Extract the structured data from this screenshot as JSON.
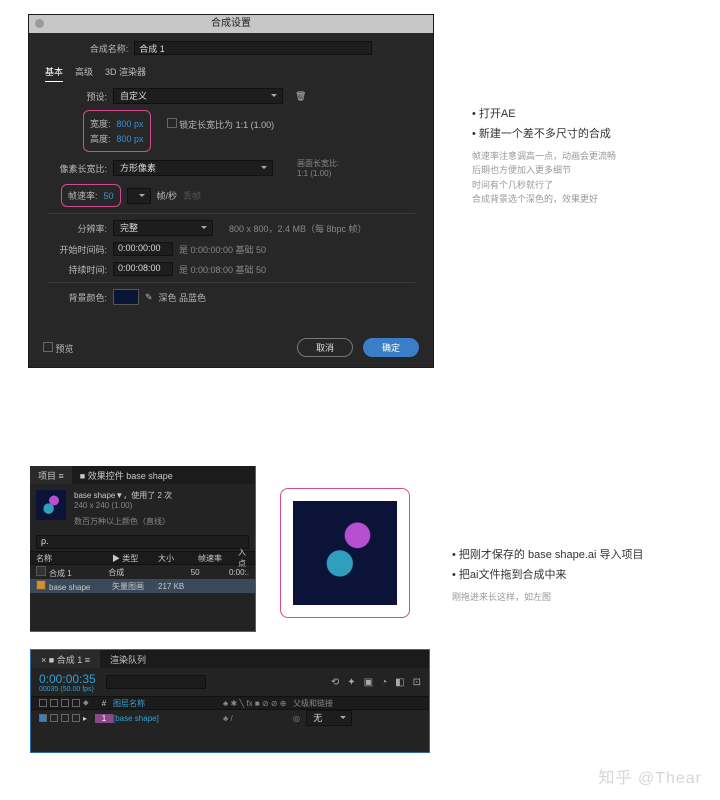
{
  "dialog": {
    "title": "合成设置",
    "name_label": "合成名称:",
    "name_value": "合成 1",
    "tabs": [
      "基本",
      "高级",
      "3D 渲染器"
    ],
    "preset_label": "预设:",
    "preset_value": "自定义",
    "width_label": "宽度:",
    "width_value": "800 px",
    "height_label": "高度:",
    "height_value": "800 px",
    "lock_aspect": "锁定长宽比为 1:1 (1.00)",
    "pixel_aspect_label": "像素长宽比:",
    "pixel_aspect_value": "方形像素",
    "frame_aspect_label": "画面长宽比:",
    "frame_aspect_value": "1:1 (1.00)",
    "fps_label": "帧速率:",
    "fps_value": "50",
    "fps_unit": "帧/秒",
    "fps_drop": "丢帧",
    "res_label": "分辨率:",
    "res_value": "完整",
    "res_info": "800 x 800，2.4 MB（每 8bpc 帧）",
    "start_label": "开始时间码:",
    "start_value": "0:00:00:00",
    "start_info": "是 0:00:00:00 基础 50",
    "dur_label": "持续时间:",
    "dur_value": "0:00:08:00",
    "dur_info": "是 0:00:08:00 基础 50",
    "bg_label": "背景颜色:",
    "bg_name": "深色 品蓝色",
    "preview_cb": "预览",
    "cancel": "取消",
    "ok": "确定"
  },
  "notes1": {
    "items": [
      "打开AE",
      "新建一个差不多尺寸的合成"
    ],
    "subs": [
      "帧速率注意调高一点，动画会更流畅",
      "后期也方便加入更多细节",
      "时间有个几秒就行了",
      "合成背景选个深色的，效果更好"
    ]
  },
  "project": {
    "tabs": {
      "a": "项目 ≡",
      "b": "■  效果控件 base shape"
    },
    "item_name": "base shape▼，使用了 2 次",
    "item_dim": "240 x 240 (1.00)",
    "item_colors": "数百万种以上颜色（直线）",
    "search_ph": "ρ.",
    "cols": {
      "name": "名称",
      "type": "▶  类型",
      "size": "大小",
      "fps": "帧速率",
      "in": "入点"
    },
    "rows": [
      {
        "name": "合成 1",
        "type": "合成",
        "size": "",
        "fps": "50",
        "in": "0:00:."
      },
      {
        "name": "base shape",
        "type": "矢量图画",
        "size": "217 KB",
        "fps": "",
        "in": ""
      }
    ]
  },
  "notes2": {
    "items": [
      "把刚才保存的 base shape.ai 导入项目",
      "把ai文件拖到合成中来"
    ],
    "sub": "刚拖进来长这样，如左图"
  },
  "timeline": {
    "tabs": {
      "a": "×  ■  合成 1  ≡",
      "b": "渲染队列"
    },
    "timecode": "0:00:00:35",
    "timecode_sub": "00035 (50.00 fps)",
    "search_ph": "ρ.",
    "head": {
      "num": "#",
      "layer": "图层名称",
      "switches": "♣ ✱ ╲ fx  ■ ⊘ ⊘ ⊕",
      "parent": "父级和链接"
    },
    "row": {
      "num": "1",
      "name": "[base shape]",
      "switches": "♣    /",
      "parent_label": "无",
      "parent_icon": "◎"
    }
  },
  "watermark": "知乎 @Thear"
}
